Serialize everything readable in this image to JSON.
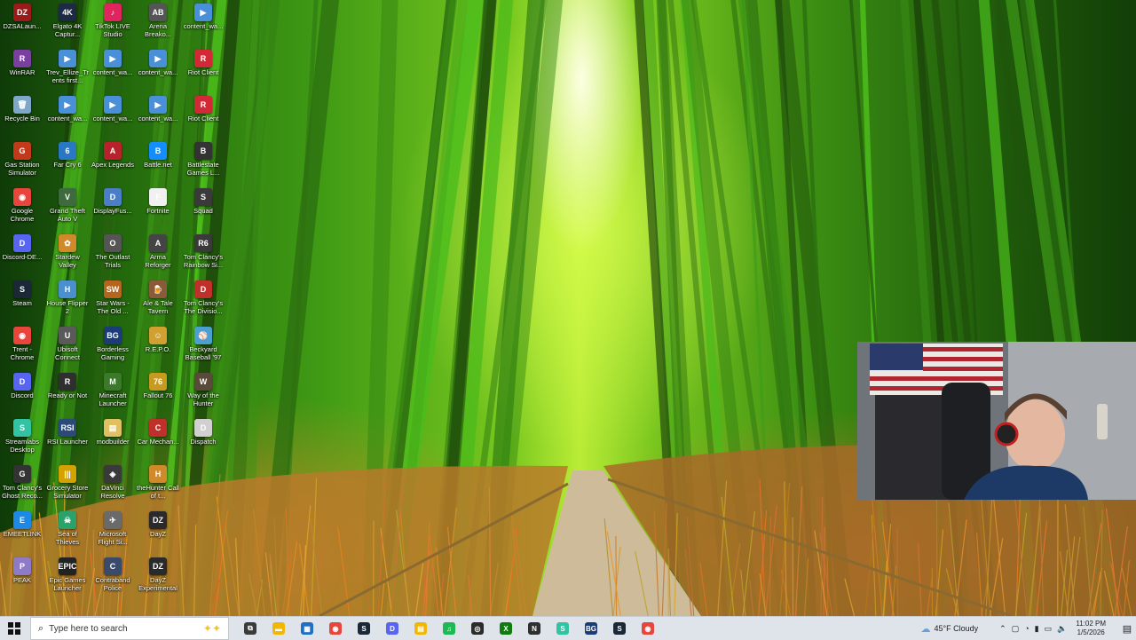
{
  "desktop_icons": [
    {
      "label": "DZSALaun...",
      "color": "#9b1b1b",
      "glyph": "DZ"
    },
    {
      "label": "WinRAR",
      "color": "#7a3fa0",
      "glyph": "R"
    },
    {
      "label": "Recycle Bin",
      "color": "#7fa7c9",
      "glyph": "🗑"
    },
    {
      "label": "Gas Station Simulator",
      "color": "#c23a1a",
      "glyph": "G"
    },
    {
      "label": "Google Chrome",
      "color": "#e8453c",
      "glyph": "◉"
    },
    {
      "label": "Discord-DE...",
      "color": "#5865f2",
      "glyph": "D"
    },
    {
      "label": "Steam",
      "color": "#1b2838",
      "glyph": "S"
    },
    {
      "label": "Trent - Chrome",
      "color": "#e8453c",
      "glyph": "◉"
    },
    {
      "label": "Discord",
      "color": "#5865f2",
      "glyph": "D"
    },
    {
      "label": "Streamlabs Desktop",
      "color": "#31c3a2",
      "glyph": "S"
    },
    {
      "label": "Tom Clancy's Ghost Reco...",
      "color": "#333333",
      "glyph": "G"
    },
    {
      "label": "EMEETLINK",
      "color": "#1e88e5",
      "glyph": "E"
    },
    {
      "label": "PEAK",
      "color": "#8f7ac7",
      "glyph": "P"
    },
    {
      "label": "Elgato 4K Captur...",
      "color": "#1c2a44",
      "glyph": "4K"
    },
    {
      "label": "Trev_Ellize_Trents first...",
      "color": "#4a90d9",
      "glyph": "▶"
    },
    {
      "label": "content_wa...",
      "color": "#4a90d9",
      "glyph": "▶"
    },
    {
      "label": "Far Cry 6",
      "color": "#2a78c4",
      "glyph": "6"
    },
    {
      "label": "Grand Theft Auto V",
      "color": "#3d6b3d",
      "glyph": "V"
    },
    {
      "label": "Stardew Valley",
      "color": "#d08a2a",
      "glyph": "✿"
    },
    {
      "label": "House Flipper 2",
      "color": "#4a8fd0",
      "glyph": "H"
    },
    {
      "label": "Ubisoft Connect",
      "color": "#5a5a5a",
      "glyph": "U"
    },
    {
      "label": "Ready or Not",
      "color": "#2f2f2f",
      "glyph": "R"
    },
    {
      "label": "RSI Launcher",
      "color": "#2a4a7a",
      "glyph": "RSI"
    },
    {
      "label": "Grocery Store Simulator",
      "color": "#d4a200",
      "glyph": "|||"
    },
    {
      "label": "Sea of Thieves",
      "color": "#2aa36b",
      "glyph": "☠"
    },
    {
      "label": "Epic Games Launcher",
      "color": "#222222",
      "glyph": "EPIC"
    },
    {
      "label": "TikTok LIVE Studio",
      "color": "#e0245e",
      "glyph": "♪"
    },
    {
      "label": "content_wa...",
      "color": "#4a90d9",
      "glyph": "▶"
    },
    {
      "label": "content_wa...",
      "color": "#4a90d9",
      "glyph": "▶"
    },
    {
      "label": "Apex Legends",
      "color": "#b8222a",
      "glyph": "A"
    },
    {
      "label": "DisplayFus...",
      "color": "#4a7ec7",
      "glyph": "D"
    },
    {
      "label": "The Outlast Trials",
      "color": "#555555",
      "glyph": "O"
    },
    {
      "label": "Star Wars - The Old ...",
      "color": "#b5651d",
      "glyph": "SW"
    },
    {
      "label": "Borderless Gaming",
      "color": "#1a3d7a",
      "glyph": "BG"
    },
    {
      "label": "Minecraft Launcher",
      "color": "#3a7a2a",
      "glyph": "M"
    },
    {
      "label": "modbuilder",
      "color": "#e0c060",
      "glyph": "▤"
    },
    {
      "label": "DaVinci Resolve",
      "color": "#3a3a3a",
      "glyph": "◈"
    },
    {
      "label": "Microsoft Flight Si...",
      "color": "#6a6a6a",
      "glyph": "✈"
    },
    {
      "label": "Contraband Police",
      "color": "#3a4a6a",
      "glyph": "C"
    },
    {
      "label": "Arena Breako...",
      "color": "#555555",
      "glyph": "AB"
    },
    {
      "label": "content_wa...",
      "color": "#4a90d9",
      "glyph": "▶"
    },
    {
      "label": "content_wa...",
      "color": "#4a90d9",
      "glyph": "▶"
    },
    {
      "label": "Battle.net",
      "color": "#148eff",
      "glyph": "B"
    },
    {
      "label": "Fortnite",
      "color": "#f0f0f0",
      "glyph": "F"
    },
    {
      "label": "Arma Reforger",
      "color": "#444444",
      "glyph": "A"
    },
    {
      "label": "Ale & Tale Tavern",
      "color": "#8a5a3a",
      "glyph": "🍺"
    },
    {
      "label": "R.E.P.O.",
      "color": "#d0a030",
      "glyph": "☺"
    },
    {
      "label": "Fallout 76",
      "color": "#c89a20",
      "glyph": "76"
    },
    {
      "label": "Car Mechan...",
      "color": "#c0302a",
      "glyph": "C"
    },
    {
      "label": "theHunter Call of t...",
      "color": "#d08a2a",
      "glyph": "H"
    },
    {
      "label": "DayZ",
      "color": "#2a2a2a",
      "glyph": "DZ"
    },
    {
      "label": "DayZ Experimental",
      "color": "#2a2a2a",
      "glyph": "DZ"
    },
    {
      "label": "content_wa...",
      "color": "#4a90d9",
      "glyph": "▶"
    },
    {
      "label": "Riot Client",
      "color": "#d32936",
      "glyph": "R"
    },
    {
      "label": "Riot Client",
      "color": "#d32936",
      "glyph": "R"
    },
    {
      "label": "Battlestate Games L...",
      "color": "#333333",
      "glyph": "B"
    },
    {
      "label": "Squad",
      "color": "#3a3a3a",
      "glyph": "S"
    },
    {
      "label": "Tom Clancy's Rainbow Si...",
      "color": "#3a3a3a",
      "glyph": "R6"
    },
    {
      "label": "Tom Clancy's The Divisio...",
      "color": "#c0302a",
      "glyph": "D"
    },
    {
      "label": "Beckyard Baseball '97",
      "color": "#4aa0d0",
      "glyph": "⚾"
    },
    {
      "label": "Way of the Hunter",
      "color": "#5a4a3a",
      "glyph": "W"
    },
    {
      "label": "Dispatch",
      "color": "#d0d0d0",
      "glyph": "D"
    }
  ],
  "taskbar": {
    "search_placeholder": "Type here to search",
    "weather": "45°F  Cloudy",
    "time": "11:02 PM",
    "date": "1/5/2026",
    "pinned": [
      {
        "name": "task-view",
        "color": "#3b3b3b",
        "glyph": "⧉"
      },
      {
        "name": "file-explorer",
        "color": "#f2b705",
        "glyph": "▬"
      },
      {
        "name": "microsoft-store",
        "color": "#1f6fc4",
        "glyph": "▦"
      },
      {
        "name": "chrome",
        "color": "#e8453c",
        "glyph": "◉"
      },
      {
        "name": "steam",
        "color": "#1b2838",
        "glyph": "S"
      },
      {
        "name": "discord",
        "color": "#5865f2",
        "glyph": "D"
      },
      {
        "name": "files",
        "color": "#f2b705",
        "glyph": "▤"
      },
      {
        "name": "spotify",
        "color": "#1db954",
        "glyph": "♫"
      },
      {
        "name": "obs",
        "color": "#2b2b2b",
        "glyph": "◎"
      },
      {
        "name": "xbox",
        "color": "#107c10",
        "glyph": "X"
      },
      {
        "name": "nvidia",
        "color": "#2f2f2f",
        "glyph": "N"
      },
      {
        "name": "streamlabs",
        "color": "#31c3a2",
        "glyph": "S"
      },
      {
        "name": "borderless-gaming",
        "color": "#1a3d7a",
        "glyph": "BG"
      },
      {
        "name": "steam-2",
        "color": "#1b2838",
        "glyph": "S"
      },
      {
        "name": "chrome-2",
        "color": "#e8453c",
        "glyph": "◉"
      }
    ]
  }
}
